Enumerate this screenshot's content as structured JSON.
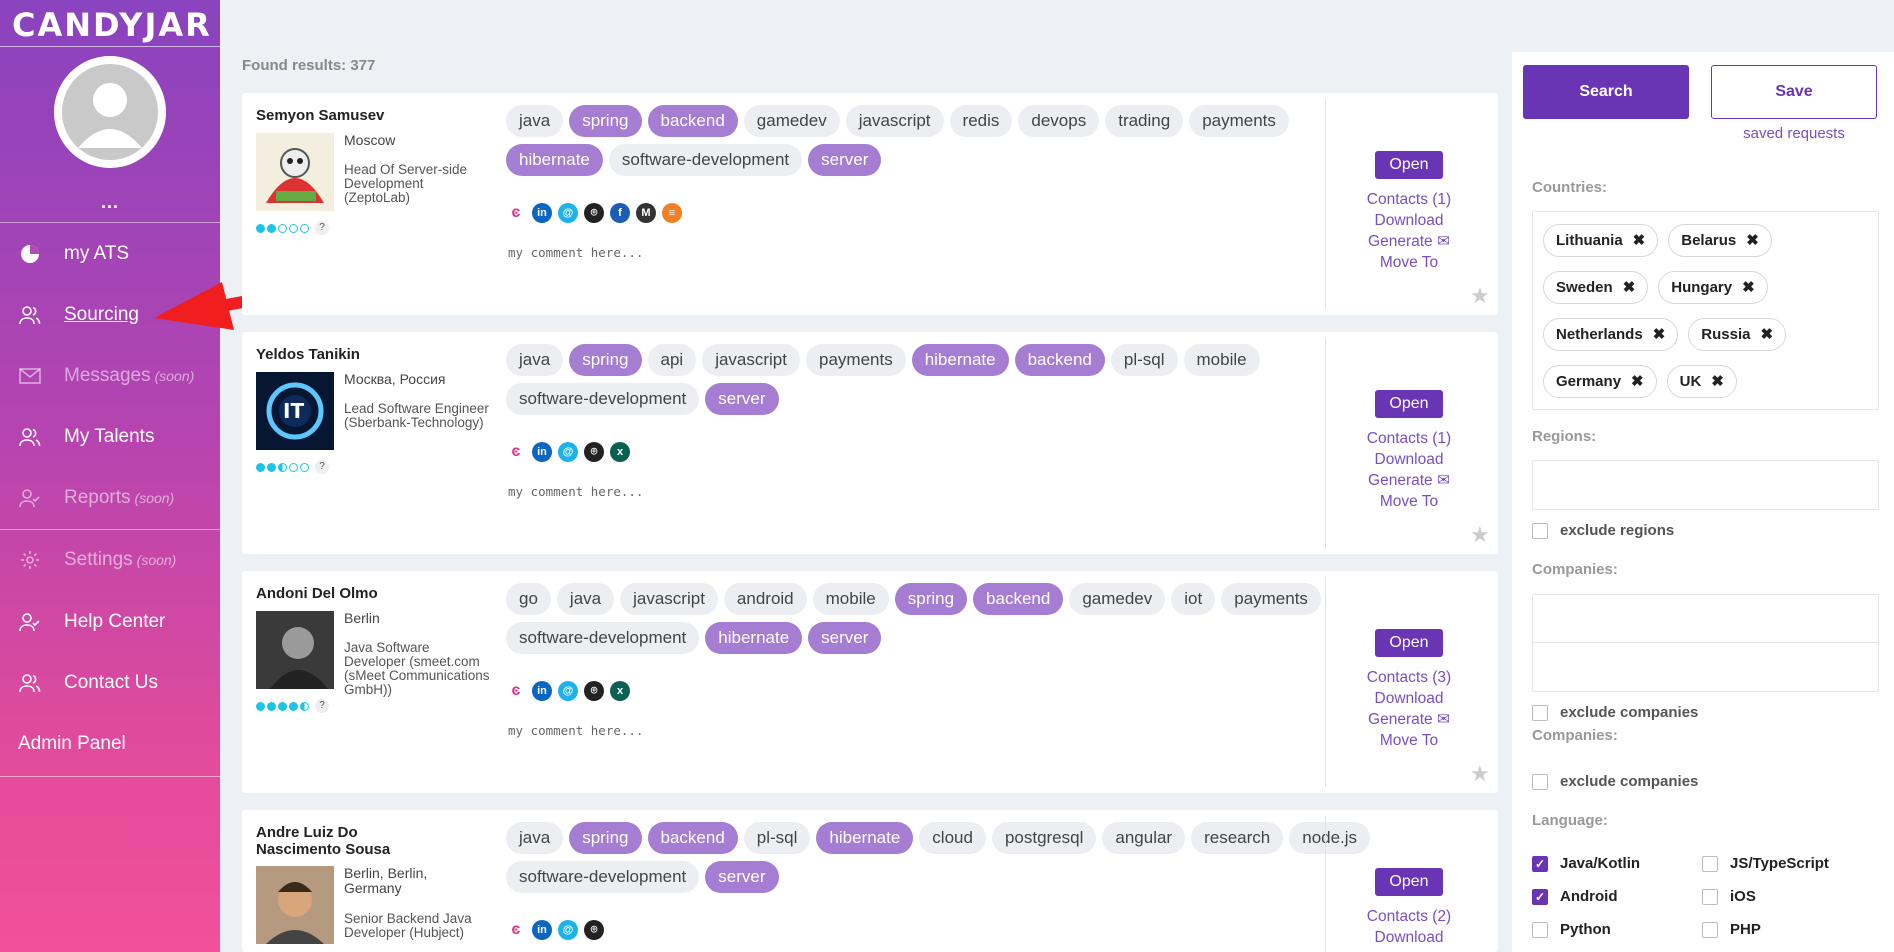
{
  "app": {
    "logo": "CANDYJAR",
    "more": "..."
  },
  "nav": [
    {
      "label": "my ATS",
      "soon": ""
    },
    {
      "label": "Sourcing",
      "soon": ""
    },
    {
      "label": "Messages",
      "soon": "(soon)"
    },
    {
      "label": "My Talents",
      "soon": ""
    },
    {
      "label": "Reports",
      "soon": "(soon)"
    },
    {
      "label": "Settings",
      "soon": "(soon)"
    },
    {
      "label": "Help Center",
      "soon": ""
    },
    {
      "label": "Contact Us",
      "soon": ""
    },
    {
      "label": "Admin Panel",
      "soon": ""
    }
  ],
  "results": {
    "found": "Found results: 377"
  },
  "candidates": [
    {
      "name": "Semyon Samusev",
      "location": "Moscow",
      "title": "Head Of Server-side Development (ZeptoLab)",
      "rating": 2,
      "tags": [
        "java",
        "spring",
        "backend",
        "gamedev",
        "javascript",
        "redis",
        "devops",
        "trading",
        "payments",
        "hibernate",
        "software-development",
        "server"
      ],
      "highlighted": [
        "spring",
        "backend",
        "hibernate",
        "server"
      ],
      "comment": "my comment here...",
      "open": "Open",
      "contacts": "Contacts (1)",
      "download": "Download",
      "generate": "Generate ✉",
      "move": "Move To"
    },
    {
      "name": "Yeldos Tanikin",
      "location": "Москва, Россия",
      "title": "Lead Software Engineer (Sberbank-Technology)",
      "rating": 2.5,
      "tags": [
        "java",
        "spring",
        "api",
        "javascript",
        "payments",
        "hibernate",
        "backend",
        "pl-sql",
        "mobile",
        "software-development",
        "server"
      ],
      "highlighted": [
        "spring",
        "hibernate",
        "backend",
        "server"
      ],
      "comment": "my comment here...",
      "open": "Open",
      "contacts": "Contacts (1)",
      "download": "Download",
      "generate": "Generate ✉",
      "move": "Move To"
    },
    {
      "name": "Andoni Del Olmo",
      "location": "Berlin",
      "title": "Java Software Developer (smeet.com (sMeet Communications GmbH))",
      "rating": 4.5,
      "tags": [
        "go",
        "java",
        "javascript",
        "android",
        "mobile",
        "spring",
        "backend",
        "gamedev",
        "iot",
        "payments",
        "software-development",
        "hibernate",
        "server"
      ],
      "highlighted": [
        "spring",
        "backend",
        "hibernate",
        "server"
      ],
      "comment": "my comment here...",
      "open": "Open",
      "contacts": "Contacts (3)",
      "download": "Download",
      "generate": "Generate ✉",
      "move": "Move To"
    },
    {
      "name": "Andre Luiz Do Nascimento Sousa",
      "location": "Berlin, Berlin, Germany",
      "title": "Senior Backend Java Developer (Hubject)",
      "rating": 0,
      "tags": [
        "java",
        "spring",
        "backend",
        "pl-sql",
        "hibernate",
        "cloud",
        "postgresql",
        "angular",
        "research",
        "node.js",
        "software-development",
        "server"
      ],
      "highlighted": [
        "spring",
        "backend",
        "hibernate",
        "server"
      ],
      "comment": "",
      "open": "Open",
      "contacts": "Contacts (2)",
      "download": "Download",
      "generate": "",
      "move": ""
    }
  ],
  "filters": {
    "search": "Search",
    "save": "Save",
    "saved_requests": "saved requests",
    "countries_label": "Countries:",
    "countries": [
      "Lithuania",
      "Belarus",
      "Sweden",
      "Hungary",
      "Netherlands",
      "Russia",
      "Germany",
      "UK"
    ],
    "regions_label": "Regions:",
    "exclude_regions": "exclude regions",
    "companies_label": "Companies:",
    "exclude_companies": "exclude companies",
    "companies_label2": "Companies:",
    "exclude_companies2": "exclude companies",
    "language_label": "Language:",
    "languages": [
      {
        "label": "Java/Kotlin",
        "checked": true
      },
      {
        "label": "JS/TypeScript",
        "checked": false
      },
      {
        "label": "Android",
        "checked": true
      },
      {
        "label": "iOS",
        "checked": false
      },
      {
        "label": "Python",
        "checked": false
      },
      {
        "label": "PHP",
        "checked": false
      }
    ]
  },
  "colors": {
    "accent": "#6a35b4",
    "tag_highlight": "#a57dd3",
    "link": "#7a4fc0"
  }
}
